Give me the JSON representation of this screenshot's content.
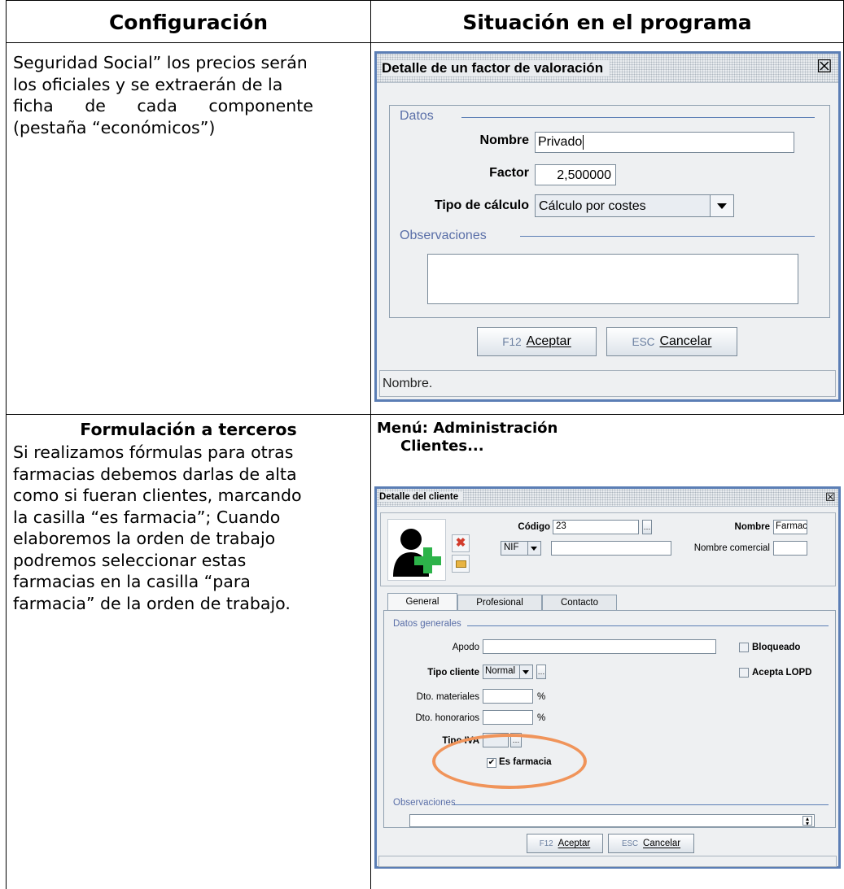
{
  "table": {
    "header_left": "Configuración",
    "header_right": "Situación en el programa"
  },
  "row1": {
    "text_lines": [
      "Seguridad Social” los precios serán",
      "los oficiales y se extraerán de la",
      "ficha de cada componente"
    ],
    "text_last": "(pestaña “económicos”)"
  },
  "dialog1": {
    "title": "Detalle de un factor de valoración",
    "close_glyph": "☒",
    "section_datos": "Datos",
    "label_nombre": "Nombre",
    "value_nombre": "Privado",
    "label_factor": "Factor",
    "value_factor": "2,500000",
    "label_tipo": "Tipo de cálculo",
    "value_tipo": "Cálculo por costes",
    "section_obs": "Observaciones",
    "btn_ok_key": "F12",
    "btn_ok": "Aceptar",
    "btn_cancel_key": "ESC",
    "btn_cancel": "Cancelar",
    "status": "Nombre."
  },
  "row2": {
    "heading": "Formulación a terceros",
    "text_lines": [
      "Si realizamos fórmulas para otras",
      "farmacias debemos darlas de alta",
      "como si fueran clientes, marcando",
      "la casilla “es farmacia”; Cuando",
      "elaboremos la orden de trabajo",
      "podremos seleccionar estas",
      "farmacias en la casilla “para"
    ],
    "text_last": "farmacia” de la orden de trabajo.",
    "menu_line1": "Menú: Administración",
    "menu_line2": "Clientes..."
  },
  "dialog2": {
    "title": "Detalle del cliente",
    "close_glyph": "☒",
    "label_codigo": "Código",
    "value_codigo": "23",
    "label_nombre": "Nombre",
    "value_nombre": "Farmac",
    "nif_select": "NIF",
    "label_nombre_comercial": "Nombre comercial",
    "tab_general": "General",
    "tab_profesional": "Profesional",
    "tab_contacto": "Contacto",
    "section_datos": "Datos generales",
    "label_apodo": "Apodo",
    "label_bloqueado": "Bloqueado",
    "label_tipo_cliente": "Tipo cliente",
    "value_tipo_cliente": "Normal",
    "label_acepta": "Acepta LOPD",
    "label_dto_mat": "Dto. materiales",
    "label_dto_hon": "Dto. honorarios",
    "pct": "%",
    "label_tipo_iva": "Tipo IVA",
    "label_es_farmacia": "Es farmacia",
    "es_farmacia_checked": true,
    "section_obs": "Observaciones",
    "btn_ok_key": "F12",
    "btn_ok": "Aceptar",
    "btn_cancel_key": "ESC",
    "btn_cancel": "Cancelar"
  },
  "colors": {
    "dialog_border": "#5b7eb5",
    "section_title": "#5a6fa8",
    "highlight_ellipse": "#f0945a",
    "delete_icon": "#d23c2c",
    "green_cross": "#2db34a"
  }
}
